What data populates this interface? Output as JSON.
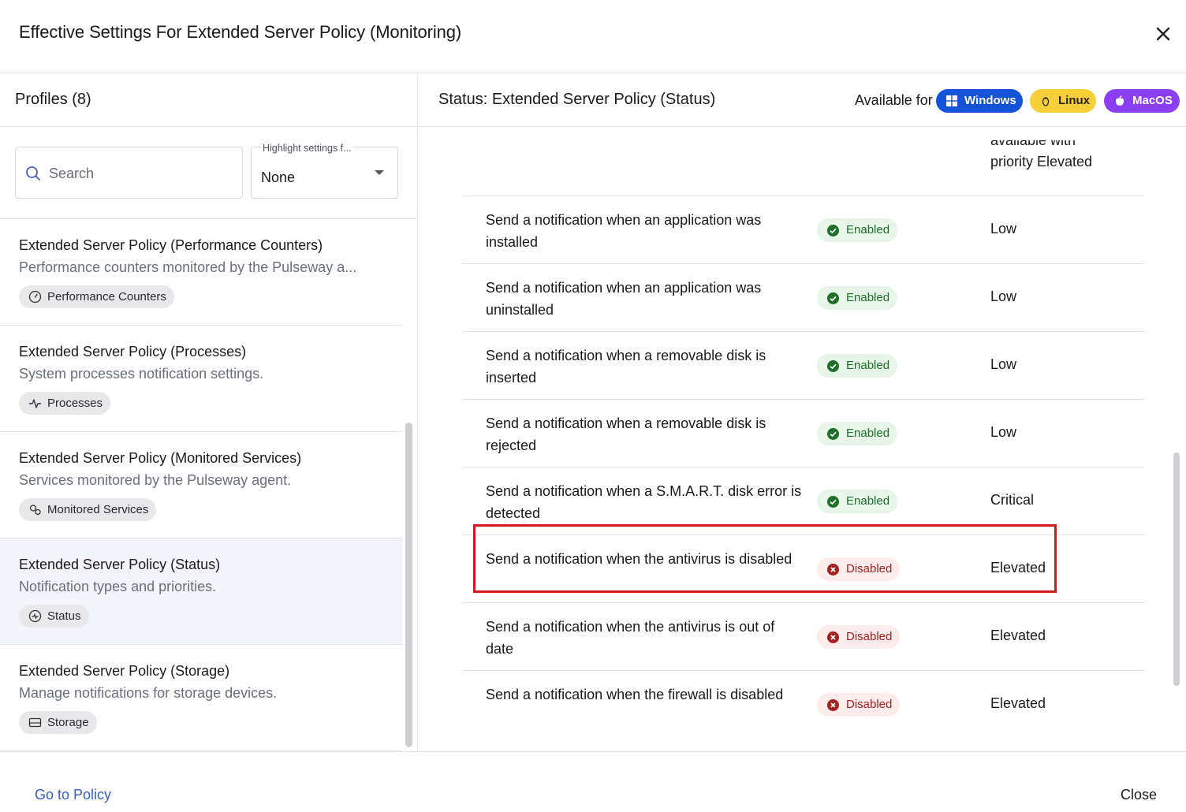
{
  "dialog": {
    "title": "Effective Settings For Extended Server Policy (Monitoring)"
  },
  "profiles_panel": {
    "heading": "Profiles (8)",
    "search_placeholder": "Search",
    "highlight_label": "Highlight settings f...",
    "highlight_value": "None",
    "items": [
      {
        "title": "Extended Server Policy (Performance Counters)",
        "description": "Performance counters monitored by the Pulseway a...",
        "chip": "Performance Counters",
        "chip_icon": "gauge-icon",
        "active": false
      },
      {
        "title": "Extended Server Policy (Processes)",
        "description": "System processes notification settings.",
        "chip": "Processes",
        "chip_icon": "pulse-icon",
        "active": false
      },
      {
        "title": "Extended Server Policy (Monitored Services)",
        "description": "Services monitored by the Pulseway agent.",
        "chip": "Monitored Services",
        "chip_icon": "gears-icon",
        "active": false
      },
      {
        "title": "Extended Server Policy (Status)",
        "description": "Notification types and priorities.",
        "chip": "Status",
        "chip_icon": "status-icon",
        "active": true
      },
      {
        "title": "Extended Server Policy (Storage)",
        "description": "Manage notifications for storage devices.",
        "chip": "Storage",
        "chip_icon": "drive-icon",
        "active": false
      }
    ]
  },
  "details_panel": {
    "title": "Status: Extended Server Policy (Status)",
    "available_for_label": "Available for",
    "platforms": [
      {
        "name": "Windows",
        "icon": "windows-icon",
        "color": "#1253d8"
      },
      {
        "name": "Linux",
        "icon": "linux-icon",
        "color": "#f6cf3a"
      },
      {
        "name": "MacOS",
        "icon": "apple-icon",
        "color": "#8b3ff0"
      }
    ],
    "partial_top_text": "available with",
    "partial_priority_text": "priority Elevated",
    "rows": [
      {
        "name": "Send a notification when an application was installed",
        "status": "Enabled",
        "priority": "Low"
      },
      {
        "name": "Send a notification when an application was uninstalled",
        "status": "Enabled",
        "priority": "Low"
      },
      {
        "name": "Send a notification when a removable disk is inserted",
        "status": "Enabled",
        "priority": "Low"
      },
      {
        "name": "Send a notification when a removable disk is rejected",
        "status": "Enabled",
        "priority": "Low"
      },
      {
        "name": "Send a notification when a S.M.A.R.T. disk error is detected",
        "status": "Enabled",
        "priority": "Critical",
        "highlighted": true
      },
      {
        "name": "Send a notification when the antivirus is disabled",
        "status": "Disabled",
        "priority": "Elevated"
      },
      {
        "name": "Send a notification when the antivirus is out of date",
        "status": "Disabled",
        "priority": "Elevated"
      },
      {
        "name": "Send a notification when the firewall is disabled",
        "status": "Disabled",
        "priority": "Elevated"
      }
    ],
    "colors": {
      "enabled": "#1f6e2a",
      "disabled": "#a32222",
      "highlight_border": "#d7171f"
    }
  },
  "footer": {
    "go_to_policy": "Go to Policy",
    "close": "Close"
  }
}
